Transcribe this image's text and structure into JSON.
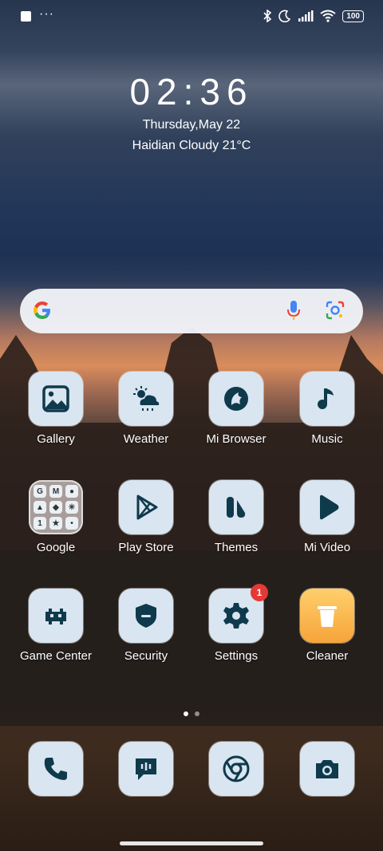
{
  "status_bar": {
    "battery": "100",
    "icons": [
      "notification-square-icon",
      "more-dots-icon",
      "bluetooth-icon",
      "moon-icon",
      "signal-icon",
      "wifi-icon",
      "battery-icon"
    ]
  },
  "clock": {
    "time": "02:36",
    "date": "Thursday,May 22",
    "weather": "Haidian Cloudy 21°C"
  },
  "search": {
    "icons": [
      "google-g-icon",
      "mic-icon",
      "lens-icon"
    ]
  },
  "apps": {
    "row1": [
      {
        "label": "Gallery",
        "icon": "gallery-icon"
      },
      {
        "label": "Weather",
        "icon": "weather-icon"
      },
      {
        "label": "Mi Browser",
        "icon": "browser-icon"
      },
      {
        "label": "Music",
        "icon": "music-icon"
      }
    ],
    "row2": [
      {
        "label": "Google",
        "icon": "google-folder-icon"
      },
      {
        "label": "Play Store",
        "icon": "play-store-icon"
      },
      {
        "label": "Themes",
        "icon": "themes-icon"
      },
      {
        "label": "Mi Video",
        "icon": "video-icon"
      }
    ],
    "row3": [
      {
        "label": "Game Center",
        "icon": "game-icon"
      },
      {
        "label": "Security",
        "icon": "security-icon"
      },
      {
        "label": "Settings",
        "icon": "gear-icon",
        "badge": "1"
      },
      {
        "label": "Cleaner",
        "icon": "trash-icon"
      }
    ]
  },
  "folder_minis": [
    "G",
    "M",
    "●",
    "▲",
    "◆",
    "✳",
    "1",
    "★",
    "•"
  ],
  "pager": {
    "pages": 2,
    "current": 1
  },
  "dock": [
    {
      "icon": "phone-icon"
    },
    {
      "icon": "messages-icon"
    },
    {
      "icon": "chrome-icon"
    },
    {
      "icon": "camera-icon"
    }
  ],
  "colors": {
    "tile_bg": "#d9e5f0",
    "icon_fg": "#0e3a4c",
    "badge": "#e53935",
    "cleaner": "#f6a43a"
  }
}
